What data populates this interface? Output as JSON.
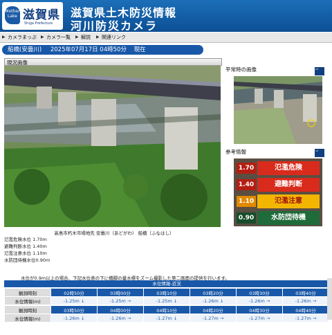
{
  "header": {
    "logo_tag": "Mother Lake",
    "logo_name": "滋賀県",
    "logo_sub": "Shiga Prefecture",
    "title_line1": "滋賀県土木防災情報",
    "title_line2": "河川防災カメラ"
  },
  "nav": [
    "カメラまっぷ",
    "カメラ一覧",
    "解説",
    "関連リンク"
  ],
  "location": {
    "station": "船橋(安曇川)",
    "datetime": "2025年07月17日 04時50分",
    "status": "現在"
  },
  "sections": {
    "current": "現況画像",
    "normal": "平常時の画像",
    "reference": "参考情報",
    "badge": "拡大表示"
  },
  "caption": "高島市朽木市場地先 安曇川（あどがわ） 船橋（ふなはし）",
  "levels": [
    {
      "label": "氾濫危険水位",
      "value": "1.70m"
    },
    {
      "label": "避難判断水位",
      "value": "1.40m"
    },
    {
      "label": "氾濫注意水位",
      "value": "1.10m"
    },
    {
      "label": "水防団待機水位",
      "value": "0.90m"
    }
  ],
  "gauge": [
    {
      "value": "1.70",
      "label": "氾濫危険",
      "color": "#d92b1c"
    },
    {
      "value": "1.40",
      "label": "避難判断",
      "color": "#d92b1c"
    },
    {
      "value": "1.10",
      "label": "氾濫注意",
      "color": "#f3b600"
    },
    {
      "value": "0.90",
      "label": "水防団待機",
      "color": "#1f6b3a"
    }
  ],
  "note": "水位が0.9m以上の場合、下記水位表の下に橋脚の量水標をズーム撮影した第二画面の提供を行います。",
  "water_table": {
    "title": "水位情報-近況",
    "time_label": "観測時刻",
    "value_label": "水位情報(m)",
    "rows": [
      {
        "times": [
          "02時50分",
          "03時00分",
          "03時10分",
          "03時20分",
          "03時30分",
          "03時40分"
        ],
        "values": [
          "-1.25m ↓",
          "-1.25m →",
          "-1.25m ↓",
          "-1.26m ↓",
          "-1.26m →",
          "-1.26m →"
        ]
      },
      {
        "times": [
          "03時50分",
          "04時00分",
          "04時10分",
          "04時20分",
          "04時30分",
          "04時40分"
        ],
        "values": [
          "-1.26m ↓",
          "-1.26m →",
          "-1.27m ↓",
          "-1.27m →",
          "-1.27m →",
          "-1.27m →"
        ]
      }
    ]
  },
  "colors": {
    "header_blue": "#1b6fb8",
    "bar_blue": "#1958a8"
  }
}
